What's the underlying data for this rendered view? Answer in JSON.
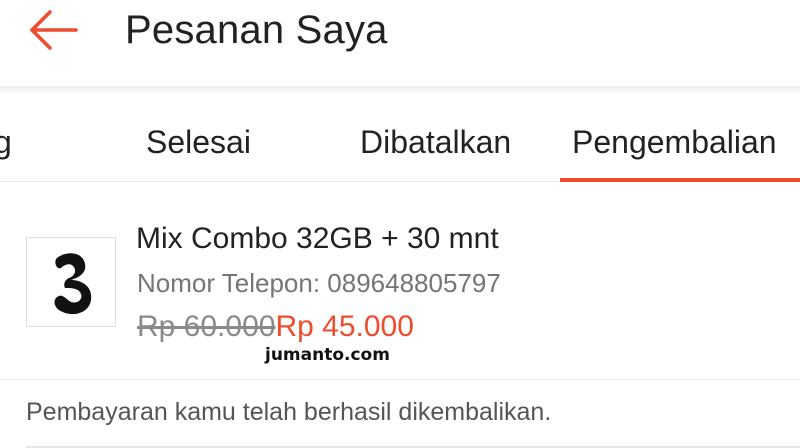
{
  "header": {
    "back_icon": "arrow-left-icon",
    "title": "Pesanan Saya",
    "accent_color": "#ee4d2d"
  },
  "tabs": {
    "items": [
      {
        "label": "g",
        "active": false
      },
      {
        "label": "Selesai",
        "active": false
      },
      {
        "label": "Dibatalkan",
        "active": false
      },
      {
        "label": "Pengembalian",
        "active": true
      }
    ]
  },
  "order": {
    "thumbnail_icon": "three-logo-icon",
    "product_name": "Mix Combo 32GB + 30 mnt",
    "phone_text": "Nomor Telepon: 089648805797",
    "old_price": "Rp 60.000",
    "new_price": "Rp 45.000",
    "price_color": "#ee4d2d"
  },
  "watermark": "jumanto.com",
  "status": {
    "message": "Pembayaran kamu telah berhasil dikembalikan."
  }
}
